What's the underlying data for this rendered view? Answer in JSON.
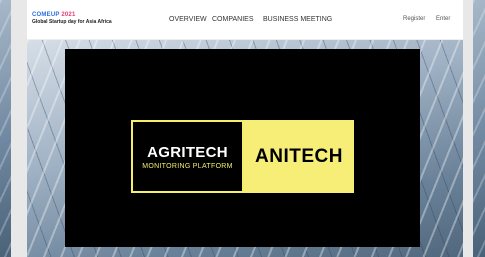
{
  "brand": {
    "logo_come": "COME",
    "logo_up": "UP",
    "logo_year": "2021",
    "tagline": "Global Startup day for Asia Africa"
  },
  "nav": {
    "overview": "OVERVIEW",
    "companies": "COMPANIES",
    "business_meeting": "BUSINESS MEETING",
    "register": "Register",
    "enter": "Enter"
  },
  "hero": {
    "card_left_title": "AGRITECH",
    "card_left_subtitle": "MONITORING PLATFORM",
    "card_right_title": "ANITECH"
  },
  "colors": {
    "accent_yellow": "#f7ee78",
    "logo_blue": "#2e6de0",
    "logo_pink": "#e53a7a"
  }
}
